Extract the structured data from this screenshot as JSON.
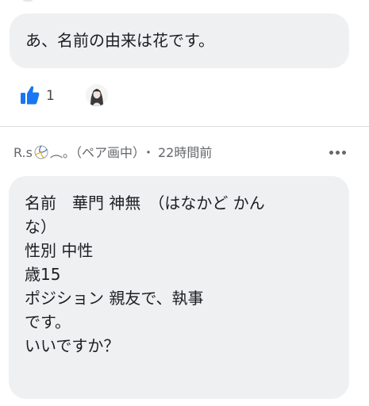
{
  "previous_comment": {
    "text": "あ、名前の由来は花です。",
    "reaction": {
      "icon": "thumbs-up-icon",
      "count": "1",
      "color": "#1877f2"
    },
    "reactor_avatar": "avatar"
  },
  "comment": {
    "author": "R.s",
    "author_emoji": "volleyball-icon",
    "author_status": "︵。（ペア画中）",
    "separator": "・",
    "timestamp": "22時間前",
    "more_icon": "more-horizontal-icon",
    "lines": [
      "名前　華門 神無　（はなかど かん",
      "な）",
      "性別 中性",
      "歳15",
      "ポジション 親友で、執事",
      "です。",
      "いいですか？"
    ]
  },
  "colors": {
    "bubble": "#eff0f2",
    "meta_text": "#65676b",
    "like_blue": "#1877f2"
  }
}
